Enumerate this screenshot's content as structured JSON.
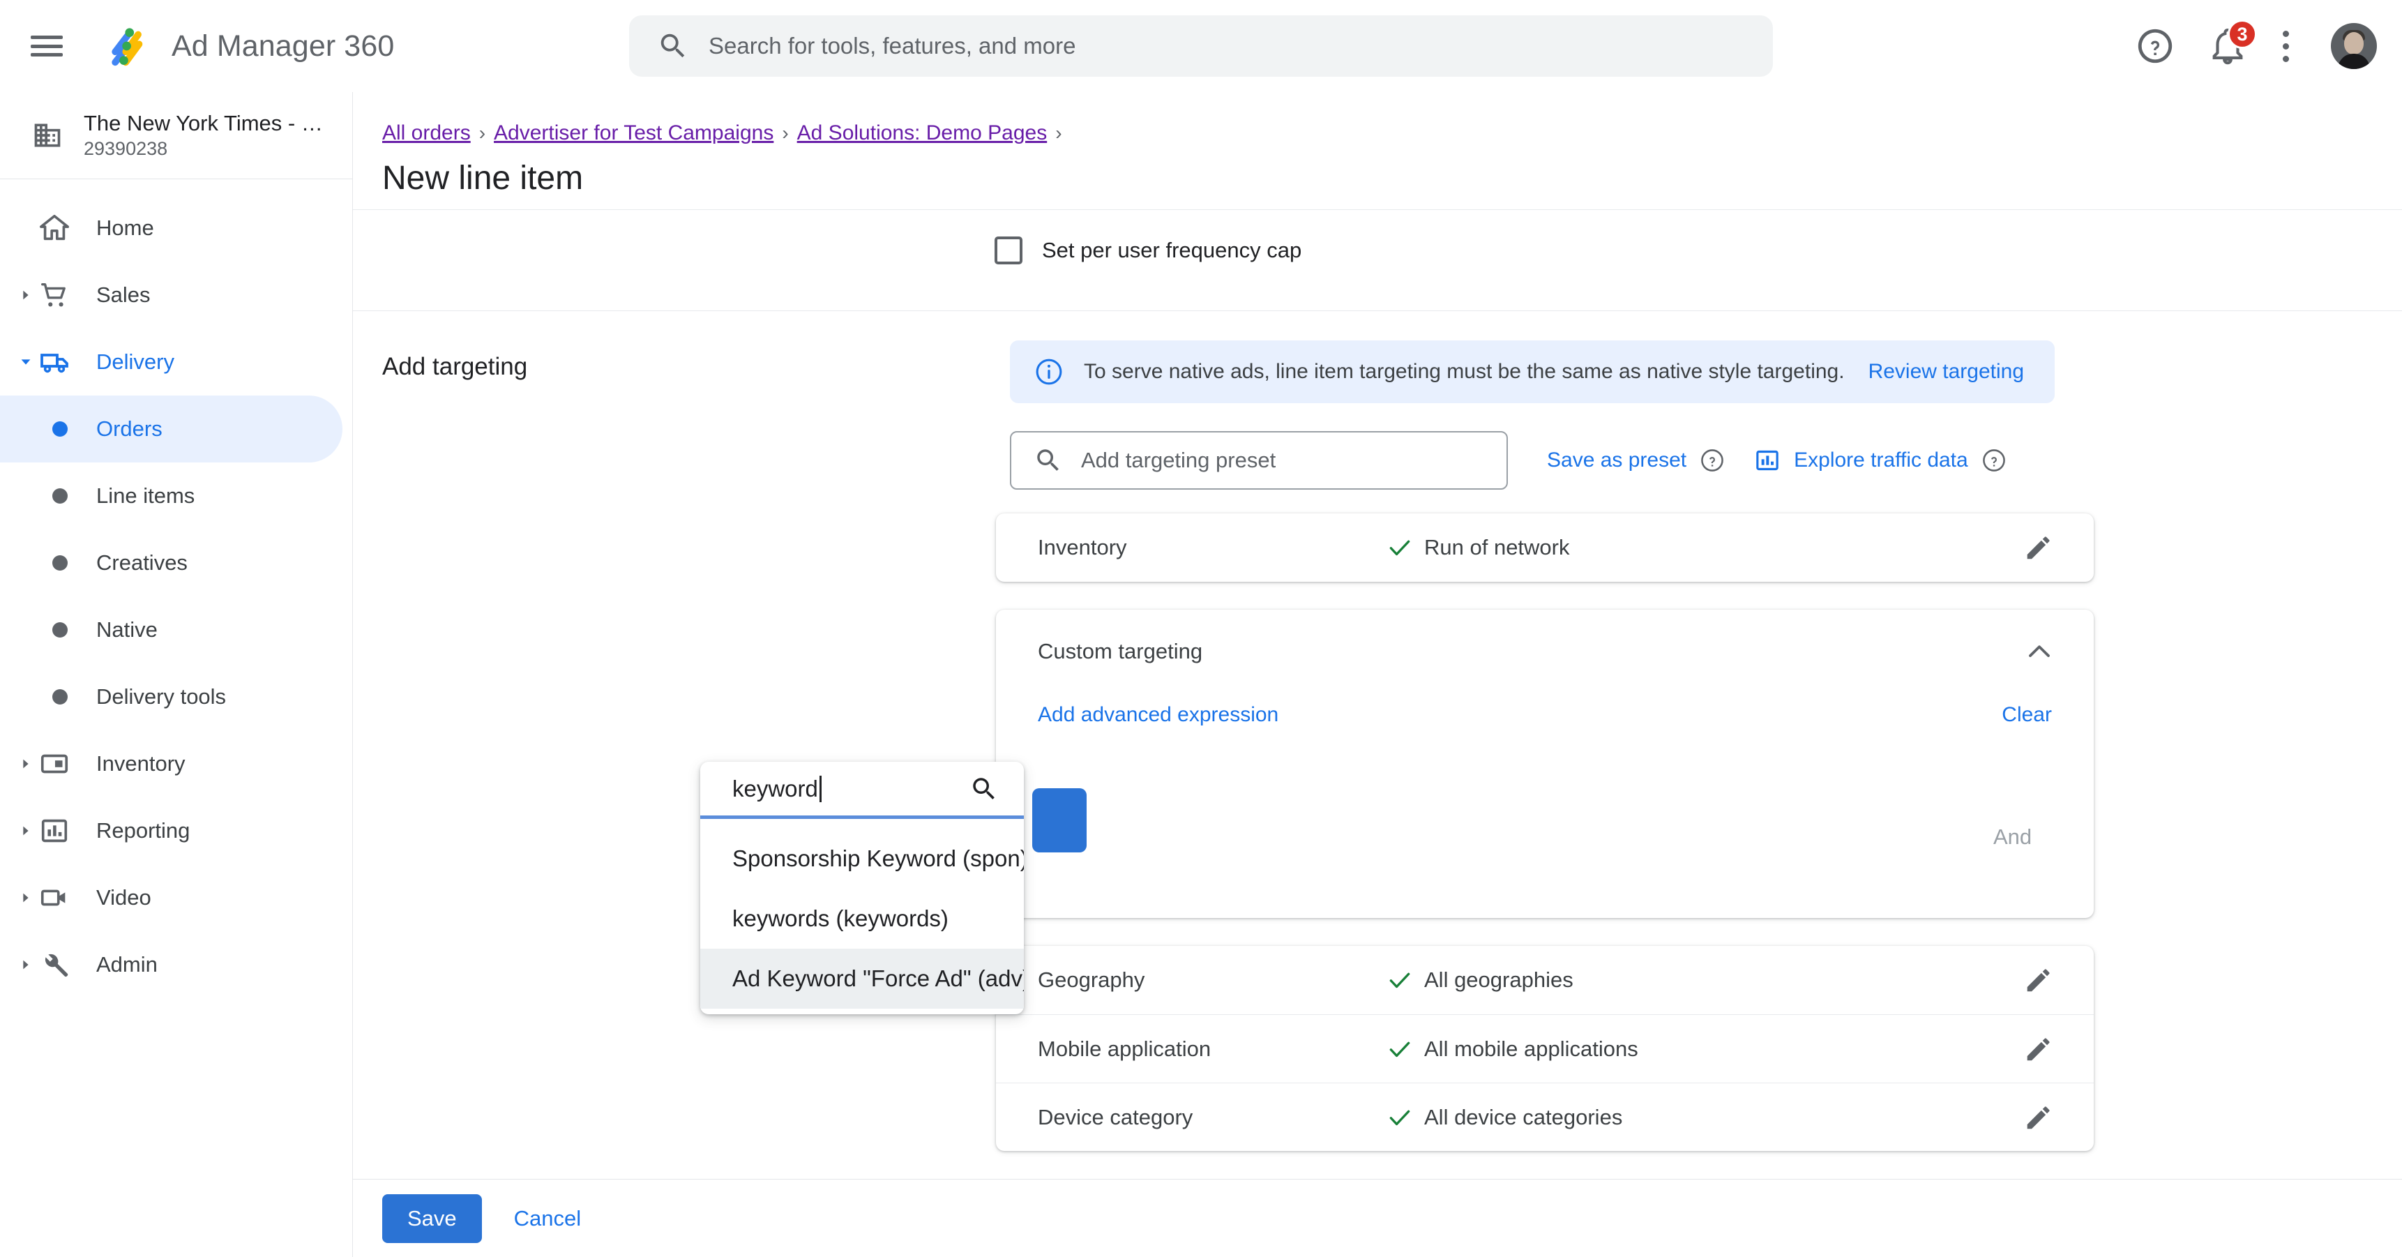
{
  "app": {
    "title": "Ad Manager 360",
    "logo_icon": "ad-manager-logo",
    "menu_icon": "hamburger-menu-icon"
  },
  "topbar": {
    "search": {
      "placeholder": "Search for tools, features, and more",
      "icon": "search-icon"
    },
    "help_icon": "help-circle-icon",
    "notifications": {
      "icon": "bell-icon",
      "count": "3"
    },
    "more_icon": "kebab-menu-icon",
    "avatar": "user-avatar"
  },
  "sidebar": {
    "network": {
      "name": "The New York Times - Pr...",
      "id": "29390238",
      "icon": "building-icon"
    },
    "items": [
      {
        "label": "Home",
        "icon": "home-icon",
        "level": "top",
        "expandable": false,
        "state": "normal"
      },
      {
        "label": "Sales",
        "icon": "shopping-cart-icon",
        "level": "top",
        "expandable": true,
        "state": "normal"
      },
      {
        "label": "Delivery",
        "icon": "truck-icon",
        "level": "top",
        "expandable": true,
        "state": "expanded"
      },
      {
        "label": "Orders",
        "icon": "dot-icon",
        "level": "child",
        "expandable": false,
        "state": "active"
      },
      {
        "label": "Line items",
        "icon": "dot-icon",
        "level": "child",
        "expandable": false,
        "state": "normal"
      },
      {
        "label": "Creatives",
        "icon": "dot-icon",
        "level": "child",
        "expandable": false,
        "state": "normal"
      },
      {
        "label": "Native",
        "icon": "dot-icon",
        "level": "child",
        "expandable": false,
        "state": "normal"
      },
      {
        "label": "Delivery tools",
        "icon": "dot-icon",
        "level": "child",
        "expandable": false,
        "state": "normal"
      },
      {
        "label": "Inventory",
        "icon": "inventory-icon",
        "level": "top",
        "expandable": true,
        "state": "normal"
      },
      {
        "label": "Reporting",
        "icon": "bar-chart-icon",
        "level": "top",
        "expandable": true,
        "state": "normal"
      },
      {
        "label": "Video",
        "icon": "video-camera-icon",
        "level": "top",
        "expandable": true,
        "state": "normal"
      },
      {
        "label": "Admin",
        "icon": "wrench-icon",
        "level": "top",
        "expandable": true,
        "state": "normal"
      }
    ]
  },
  "page": {
    "breadcrumb": [
      "All orders",
      "Advertiser for Test Campaigns",
      "Ad Solutions: Demo Pages"
    ],
    "breadcrumb_separator": "›",
    "title": "New line item"
  },
  "frequency_cap": {
    "label": "Set per user frequency cap",
    "checked": false
  },
  "targeting": {
    "section_label": "Add targeting",
    "banner": {
      "icon": "info-circle-icon",
      "text": "To serve native ads, line item targeting must be the same as native style targeting.",
      "link": "Review targeting"
    },
    "preset_search": {
      "placeholder": "Add targeting preset",
      "value": "",
      "icon": "search-icon"
    },
    "save_as_preset": "Save as preset",
    "save_as_preset_help_icon": "help-circle-icon",
    "explore_traffic": "Explore traffic data",
    "explore_traffic_icon": "bar-chart-icon",
    "explore_traffic_help_icon": "help-circle-icon",
    "inventory_row": {
      "name": "Inventory",
      "value": "Run of network",
      "check_icon": "green-check-icon",
      "edit_icon": "pencil-edit-icon"
    },
    "custom": {
      "title": "Custom targeting",
      "collapse_icon": "chevron-up-icon",
      "add_advanced": "Add advanced expression",
      "clear": "Clear",
      "and_placeholder": "And"
    },
    "rows": [
      {
        "name": "Geography",
        "value": "All geographies",
        "check_icon": "green-check-icon",
        "edit_icon": "pencil-edit-icon"
      },
      {
        "name": "Mobile application",
        "value": "All mobile applications",
        "check_icon": "green-check-icon",
        "edit_icon": "pencil-edit-icon"
      },
      {
        "name": "Device category",
        "value": "All device categories",
        "check_icon": "green-check-icon",
        "edit_icon": "pencil-edit-icon"
      }
    ]
  },
  "dropdown": {
    "search_value": "keyword",
    "search_icon": "search-icon",
    "options": [
      {
        "label": "Sponsorship Keyword (spon)",
        "hovered": false
      },
      {
        "label": "keywords (keywords)",
        "hovered": false
      },
      {
        "label": "Ad Keyword \"Force Ad\" (adv)",
        "hovered": true
      }
    ]
  },
  "footer": {
    "save": "Save",
    "cancel": "Cancel"
  },
  "colors": {
    "accent_blue": "#1a73e8",
    "button_blue": "#2b73d4",
    "link_purple": "#681da8",
    "check_green": "#188038",
    "badge_red": "#d93025",
    "banner_bg": "#e8f0fe",
    "active_nav_bg": "#e8f0fe"
  }
}
